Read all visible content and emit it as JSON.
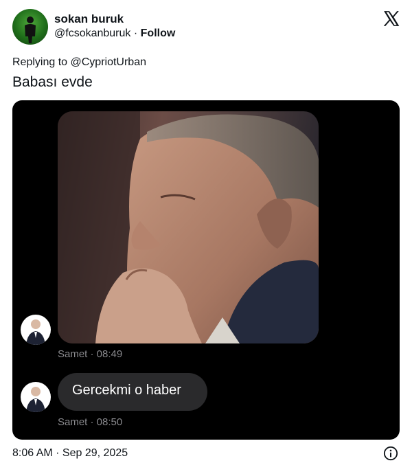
{
  "author": {
    "name": "sokan buruk",
    "handle": "@fcsokanburuk",
    "separator": "·",
    "follow_label": "Follow"
  },
  "reply": {
    "prefix": "Replying to",
    "to": "@CypriotUrban"
  },
  "tweet": {
    "text": "Babası evde"
  },
  "media": {
    "messages": [
      {
        "type": "photo",
        "sender": "Samet",
        "time": "08:49",
        "meta": "Samet · 08:49"
      },
      {
        "type": "text",
        "sender": "Samet",
        "time": "08:50",
        "text": "Gercekmi o haber",
        "meta": "Samet · 08:50"
      }
    ]
  },
  "footer": {
    "timestamp": "8:06 AM · Sep 29, 2025"
  },
  "icons": {
    "platform": "x-logo-icon",
    "info": "info-icon"
  },
  "colors": {
    "text": "#0f1419",
    "media_background": "#000000",
    "bubble": "#2a2a2c",
    "meta": "#8a8a8e",
    "avatar_green": "#2f8a26"
  }
}
